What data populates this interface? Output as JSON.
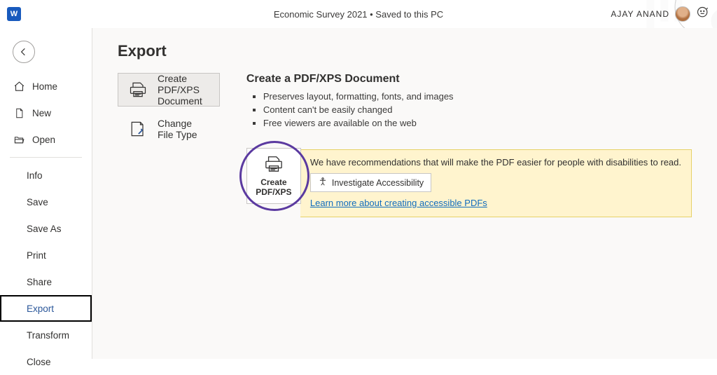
{
  "titlebar": {
    "doc_title": "Economic Survey 2021 • Saved to this PC",
    "username": "AJAY ANAND"
  },
  "sidebar": {
    "top": [
      {
        "label": "Home",
        "icon": "home"
      },
      {
        "label": "New",
        "icon": "new"
      },
      {
        "label": "Open",
        "icon": "open"
      }
    ],
    "bottom": [
      {
        "label": "Info"
      },
      {
        "label": "Save"
      },
      {
        "label": "Save As"
      },
      {
        "label": "Print"
      },
      {
        "label": "Share"
      },
      {
        "label": "Export",
        "active": true
      },
      {
        "label": "Transform"
      },
      {
        "label": "Close"
      }
    ]
  },
  "page": {
    "title": "Export",
    "options": {
      "pdf_xps": "Create PDF/XPS Document",
      "change_type": "Change File Type"
    },
    "details": {
      "heading": "Create a PDF/XPS Document",
      "bullets": [
        "Preserves layout, formatting, fonts, and images",
        "Content can't be easily changed",
        "Free viewers are available on the web"
      ]
    },
    "action": {
      "button_line1": "Create",
      "button_line2": "PDF/XPS",
      "a11y_text": "We have recommendations that will make the PDF easier for people with disabilities to read.",
      "investigate": "Investigate Accessibility",
      "learn_more": "Learn more about creating accessible PDFs"
    }
  }
}
